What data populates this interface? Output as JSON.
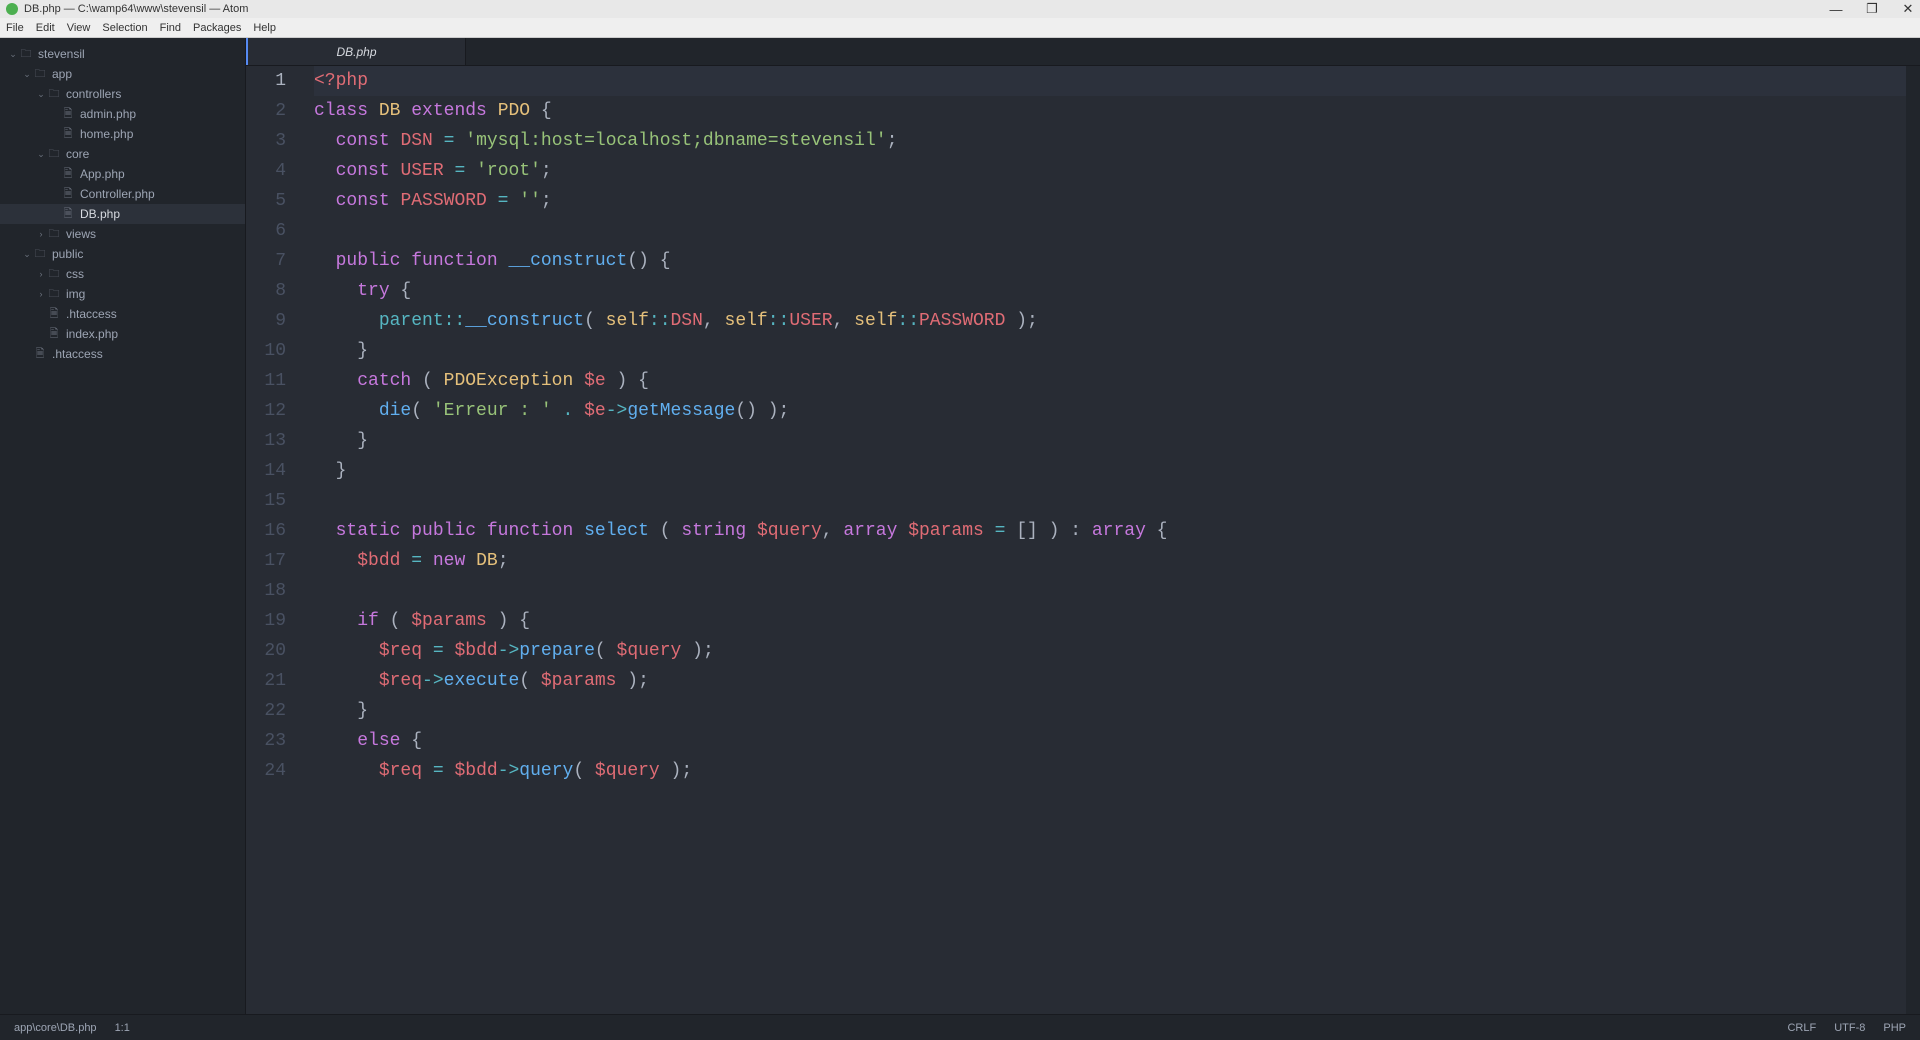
{
  "window": {
    "title": "DB.php — C:\\wamp64\\www\\stevensil — Atom"
  },
  "window_controls": {
    "min": "—",
    "max": "❐",
    "close": "✕"
  },
  "menus": [
    "File",
    "Edit",
    "View",
    "Selection",
    "Find",
    "Packages",
    "Help"
  ],
  "tree": {
    "root": "stevensil",
    "items": [
      {
        "depth": 0,
        "kind": "folder",
        "open": true,
        "label": "stevensil"
      },
      {
        "depth": 1,
        "kind": "folder",
        "open": true,
        "label": "app"
      },
      {
        "depth": 2,
        "kind": "folder",
        "open": true,
        "label": "controllers"
      },
      {
        "depth": 3,
        "kind": "file",
        "open": null,
        "label": "admin.php"
      },
      {
        "depth": 3,
        "kind": "file",
        "open": null,
        "label": "home.php"
      },
      {
        "depth": 2,
        "kind": "folder",
        "open": true,
        "label": "core"
      },
      {
        "depth": 3,
        "kind": "file",
        "open": null,
        "label": "App.php"
      },
      {
        "depth": 3,
        "kind": "file",
        "open": null,
        "label": "Controller.php"
      },
      {
        "depth": 3,
        "kind": "file",
        "open": null,
        "label": "DB.php",
        "selected": true
      },
      {
        "depth": 2,
        "kind": "folder",
        "open": false,
        "label": "views"
      },
      {
        "depth": 1,
        "kind": "folder",
        "open": true,
        "label": "public"
      },
      {
        "depth": 2,
        "kind": "folder",
        "open": false,
        "label": "css"
      },
      {
        "depth": 2,
        "kind": "folder",
        "open": false,
        "label": "img"
      },
      {
        "depth": 2,
        "kind": "file",
        "open": null,
        "label": ".htaccess"
      },
      {
        "depth": 2,
        "kind": "file",
        "open": null,
        "label": "index.php"
      },
      {
        "depth": 1,
        "kind": "file",
        "open": null,
        "label": ".htaccess"
      }
    ]
  },
  "tab": {
    "label": "DB.php"
  },
  "gutter": [
    "1",
    "2",
    "3",
    "4",
    "5",
    "6",
    "7",
    "8",
    "9",
    "10",
    "11",
    "12",
    "13",
    "14",
    "15",
    "16",
    "17",
    "18",
    "19",
    "20",
    "21",
    "22",
    "23",
    "24"
  ],
  "active_line": 1,
  "code": [
    [
      [
        "tag",
        "<?php"
      ]
    ],
    [
      [
        "keyword",
        "class"
      ],
      [
        "punct",
        " "
      ],
      [
        "class",
        "DB"
      ],
      [
        "punct",
        " "
      ],
      [
        "keyword",
        "extends"
      ],
      [
        "punct",
        " "
      ],
      [
        "class",
        "PDO"
      ],
      [
        "punct",
        " {"
      ]
    ],
    [
      [
        "punct",
        "  "
      ],
      [
        "keyword",
        "const"
      ],
      [
        "punct",
        " "
      ],
      [
        "const",
        "DSN"
      ],
      [
        "punct",
        " "
      ],
      [
        "op",
        "="
      ],
      [
        "punct",
        " "
      ],
      [
        "string",
        "'mysql:host=localhost;dbname=stevensil'"
      ],
      [
        "punct",
        ";"
      ]
    ],
    [
      [
        "punct",
        "  "
      ],
      [
        "keyword",
        "const"
      ],
      [
        "punct",
        " "
      ],
      [
        "const",
        "USER"
      ],
      [
        "punct",
        " "
      ],
      [
        "op",
        "="
      ],
      [
        "punct",
        " "
      ],
      [
        "string",
        "'root'"
      ],
      [
        "punct",
        ";"
      ]
    ],
    [
      [
        "punct",
        "  "
      ],
      [
        "keyword",
        "const"
      ],
      [
        "punct",
        " "
      ],
      [
        "const",
        "PASSWORD"
      ],
      [
        "punct",
        " "
      ],
      [
        "op",
        "="
      ],
      [
        "punct",
        " "
      ],
      [
        "string",
        "''"
      ],
      [
        "punct",
        ";"
      ]
    ],
    [],
    [
      [
        "punct",
        "  "
      ],
      [
        "keyword",
        "public"
      ],
      [
        "punct",
        " "
      ],
      [
        "keyword",
        "function"
      ],
      [
        "punct",
        " "
      ],
      [
        "func",
        "__construct"
      ],
      [
        "punct",
        "() {"
      ]
    ],
    [
      [
        "punct",
        "    "
      ],
      [
        "keyword",
        "try"
      ],
      [
        "punct",
        " {"
      ]
    ],
    [
      [
        "punct",
        "      "
      ],
      [
        "builtin",
        "parent"
      ],
      [
        "op",
        "::"
      ],
      [
        "func",
        "__construct"
      ],
      [
        "punct",
        "( "
      ],
      [
        "self",
        "self"
      ],
      [
        "op",
        "::"
      ],
      [
        "const",
        "DSN"
      ],
      [
        "punct",
        ", "
      ],
      [
        "self",
        "self"
      ],
      [
        "op",
        "::"
      ],
      [
        "const",
        "USER"
      ],
      [
        "punct",
        ", "
      ],
      [
        "self",
        "self"
      ],
      [
        "op",
        "::"
      ],
      [
        "const",
        "PASSWORD"
      ],
      [
        "punct",
        " );"
      ]
    ],
    [
      [
        "punct",
        "    }"
      ]
    ],
    [
      [
        "punct",
        "    "
      ],
      [
        "keyword",
        "catch"
      ],
      [
        "punct",
        " ( "
      ],
      [
        "class",
        "PDOException"
      ],
      [
        "punct",
        " "
      ],
      [
        "var",
        "$e"
      ],
      [
        "punct",
        " ) {"
      ]
    ],
    [
      [
        "punct",
        "      "
      ],
      [
        "func",
        "die"
      ],
      [
        "punct",
        "( "
      ],
      [
        "string",
        "'Erreur : '"
      ],
      [
        "punct",
        " "
      ],
      [
        "op",
        "."
      ],
      [
        "punct",
        " "
      ],
      [
        "var",
        "$e"
      ],
      [
        "op",
        "->"
      ],
      [
        "func",
        "getMessage"
      ],
      [
        "punct",
        "() );"
      ]
    ],
    [
      [
        "punct",
        "    }"
      ]
    ],
    [
      [
        "punct",
        "  }"
      ]
    ],
    [],
    [
      [
        "punct",
        "  "
      ],
      [
        "keyword",
        "static"
      ],
      [
        "punct",
        " "
      ],
      [
        "keyword",
        "public"
      ],
      [
        "punct",
        " "
      ],
      [
        "keyword",
        "function"
      ],
      [
        "punct",
        " "
      ],
      [
        "func",
        "select"
      ],
      [
        "punct",
        " ( "
      ],
      [
        "keyword",
        "string"
      ],
      [
        "punct",
        " "
      ],
      [
        "var",
        "$query"
      ],
      [
        "punct",
        ", "
      ],
      [
        "keyword",
        "array"
      ],
      [
        "punct",
        " "
      ],
      [
        "var",
        "$params"
      ],
      [
        "punct",
        " "
      ],
      [
        "op",
        "="
      ],
      [
        "punct",
        " [] ) : "
      ],
      [
        "keyword",
        "array"
      ],
      [
        "punct",
        " {"
      ]
    ],
    [
      [
        "punct",
        "    "
      ],
      [
        "var",
        "$bdd"
      ],
      [
        "punct",
        " "
      ],
      [
        "op",
        "="
      ],
      [
        "punct",
        " "
      ],
      [
        "keyword",
        "new"
      ],
      [
        "punct",
        " "
      ],
      [
        "class",
        "DB"
      ],
      [
        "punct",
        ";"
      ]
    ],
    [],
    [
      [
        "punct",
        "    "
      ],
      [
        "keyword",
        "if"
      ],
      [
        "punct",
        " ( "
      ],
      [
        "var",
        "$params"
      ],
      [
        "punct",
        " ) {"
      ]
    ],
    [
      [
        "punct",
        "      "
      ],
      [
        "var",
        "$req"
      ],
      [
        "punct",
        " "
      ],
      [
        "op",
        "="
      ],
      [
        "punct",
        " "
      ],
      [
        "var",
        "$bdd"
      ],
      [
        "op",
        "->"
      ],
      [
        "func",
        "prepare"
      ],
      [
        "punct",
        "( "
      ],
      [
        "var",
        "$query"
      ],
      [
        "punct",
        " );"
      ]
    ],
    [
      [
        "punct",
        "      "
      ],
      [
        "var",
        "$req"
      ],
      [
        "op",
        "->"
      ],
      [
        "func",
        "execute"
      ],
      [
        "punct",
        "( "
      ],
      [
        "var",
        "$params"
      ],
      [
        "punct",
        " );"
      ]
    ],
    [
      [
        "punct",
        "    }"
      ]
    ],
    [
      [
        "punct",
        "    "
      ],
      [
        "keyword",
        "else"
      ],
      [
        "punct",
        " {"
      ]
    ],
    [
      [
        "punct",
        "      "
      ],
      [
        "var",
        "$req"
      ],
      [
        "punct",
        " "
      ],
      [
        "op",
        "="
      ],
      [
        "punct",
        " "
      ],
      [
        "var",
        "$bdd"
      ],
      [
        "op",
        "->"
      ],
      [
        "func",
        "query"
      ],
      [
        "punct",
        "( "
      ],
      [
        "var",
        "$query"
      ],
      [
        "punct",
        " );"
      ]
    ]
  ],
  "status": {
    "path": "app\\core\\DB.php",
    "cursor": "1:1",
    "eol": "CRLF",
    "encoding": "UTF-8",
    "lang": "PHP"
  }
}
